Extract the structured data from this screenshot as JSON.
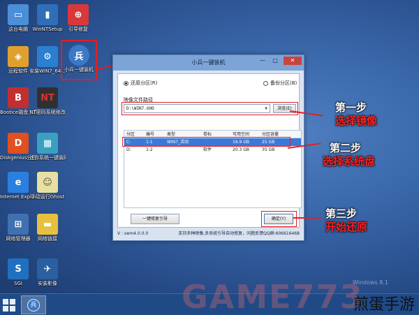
{
  "desktop_icons": [
    {
      "label": "这台电脑",
      "icon": "computer-icon",
      "color": "#4a8fd8"
    },
    {
      "label": "WinNTSetup",
      "icon": "setup-icon",
      "color": "#2f6fb8"
    },
    {
      "label": "引导修复",
      "icon": "repair-icon",
      "color": "#d8383a"
    },
    {
      "label": "远程软件",
      "icon": "remote-icon",
      "color": "#e0a030"
    },
    {
      "label": "安装WIN7_64...",
      "icon": "install-icon",
      "color": "#2a7fd0"
    },
    {
      "label": "小兵一键装机",
      "icon": "xiaobing-icon",
      "color": "#3a78c8"
    },
    {
      "label": "Bootice磁盘工具",
      "icon": "bootice-icon",
      "color": "#c03030"
    },
    {
      "label": "NT密码系统修改",
      "icon": "nt-password-icon",
      "color": "#303030"
    },
    {
      "label": "Diskgenius分区工具",
      "icon": "diskgenius-icon",
      "color": "#e05020"
    },
    {
      "label": "迷你系统一键装网速",
      "icon": "mini-system-icon",
      "color": "#3aa0c0"
    },
    {
      "label": "Internet Explorer",
      "icon": "ie-icon",
      "color": "#2a80e0"
    },
    {
      "label": "手动运行Ghost",
      "icon": "ghost-icon",
      "color": "#e8e0a0"
    },
    {
      "label": "网络管理器",
      "icon": "network-icon",
      "color": "#4070b0"
    },
    {
      "label": "网络链接",
      "icon": "folder-icon",
      "color": "#e8c040"
    },
    {
      "label": "SGI",
      "icon": "sgi-icon",
      "color": "#2070c0"
    },
    {
      "label": "安装影像",
      "icon": "image-install-icon",
      "color": "#2a5fa0"
    }
  ],
  "window": {
    "title": "小兵一键装机",
    "min": "—",
    "max": "□",
    "close": "✕",
    "radio_restore": "还原分区(R)",
    "radio_backup": "备份分区(B)",
    "path_label": "映像文件路径",
    "path_value": "D:\\WIN7.GHO",
    "browse": "浏览(E)",
    "columns": [
      "分区",
      "编号",
      "类型",
      "卷标",
      "可用空间",
      "分区容量"
    ],
    "rows": [
      [
        "C:",
        "1:1",
        "WIN7_活动",
        "",
        "16.9 GB",
        "25 GB"
      ],
      [
        "D:",
        "1:2",
        "",
        "软件",
        "20.3 GB",
        "35 GB"
      ]
    ],
    "repair_button": "一键修复引导",
    "ok_button": "确定(Y)",
    "version": "V : oem4.0.0.0",
    "support": "支持多种映像,多系统引导自动修复，问题反馈QQ群:606616468"
  },
  "steps": [
    {
      "title": "第一步",
      "sub": "选择镜像"
    },
    {
      "title": "第二步",
      "sub": "选择系统盘"
    },
    {
      "title": "第三步",
      "sub": "开始还原"
    }
  ],
  "watermark": "GAME773",
  "windows_version": "Windows 8.1",
  "brand": "煎蛋手游",
  "colors": {
    "highlight": "#e02020",
    "selection": "#3c78d8"
  }
}
